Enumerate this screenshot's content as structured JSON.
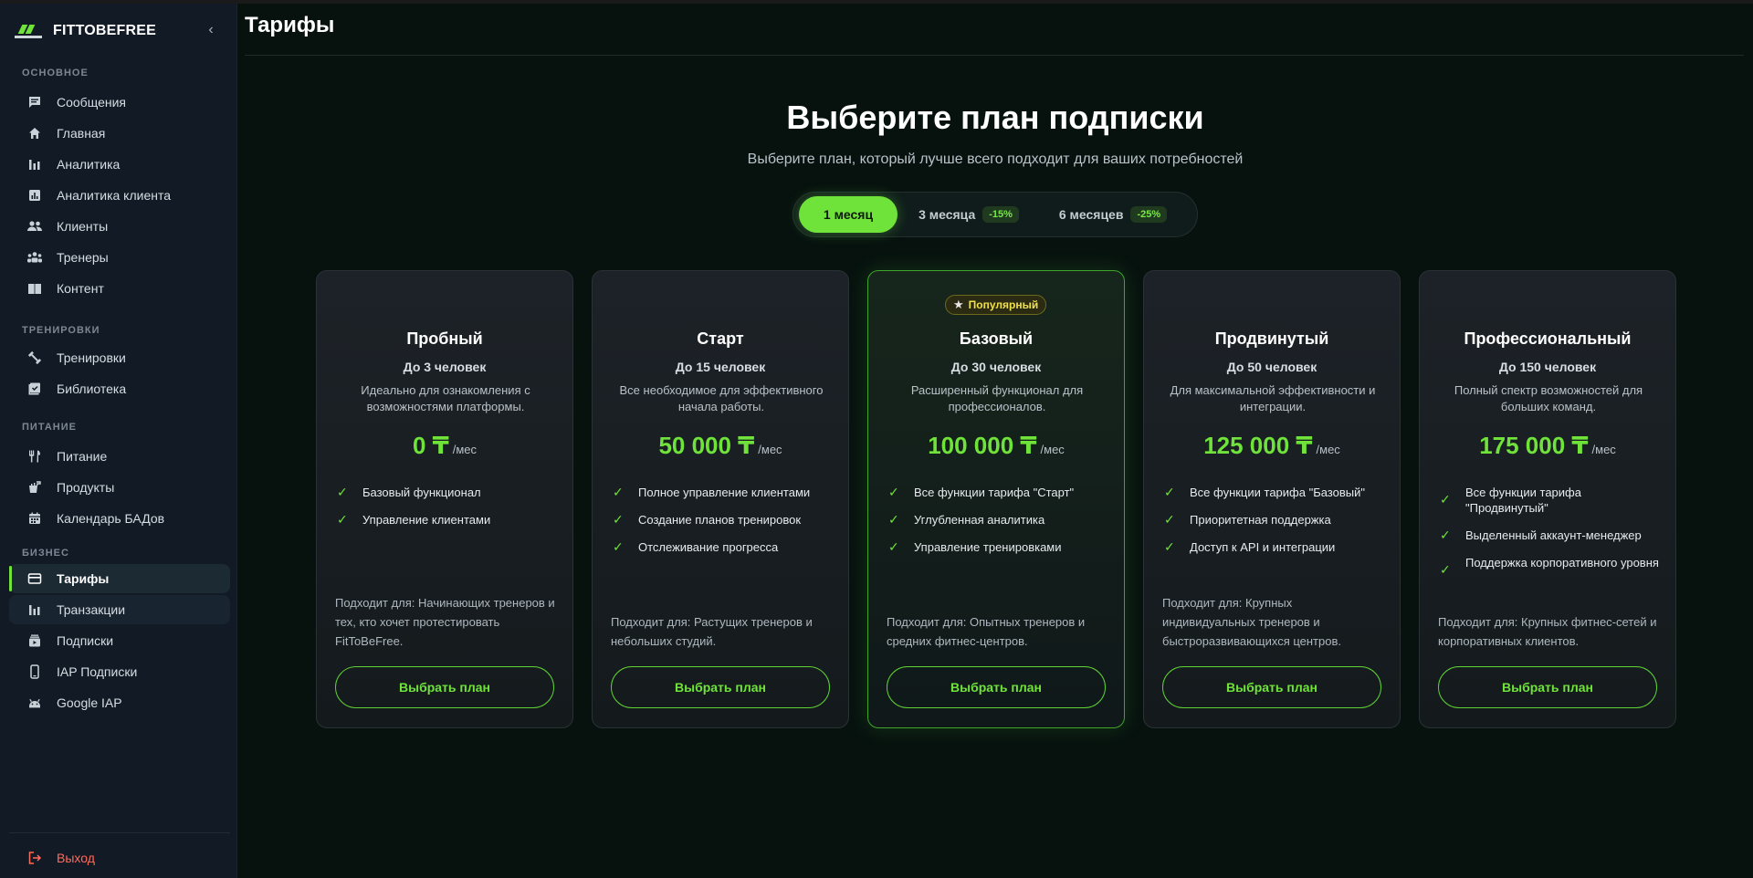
{
  "app": {
    "brand_name": "FITTOBEFREE",
    "collapse_icon": "chevron-left-icon"
  },
  "sidebar": {
    "sections": [
      {
        "title": "ОСНОВНОЕ",
        "items": [
          {
            "label": "Сообщения",
            "icon": "chat-icon"
          },
          {
            "label": "Главная",
            "icon": "home-icon"
          },
          {
            "label": "Аналитика",
            "icon": "bar-chart-icon"
          },
          {
            "label": "Аналитика клиента",
            "icon": "report-icon"
          },
          {
            "label": "Клиенты",
            "icon": "people-icon"
          },
          {
            "label": "Тренеры",
            "icon": "groups-icon"
          },
          {
            "label": "Контент",
            "icon": "book-icon"
          }
        ]
      },
      {
        "title": "ТРЕНИРОВКИ",
        "items": [
          {
            "label": "Тренировки",
            "icon": "dumbbell-icon"
          },
          {
            "label": "Библиотека",
            "icon": "library-icon"
          }
        ]
      },
      {
        "title": "ПИТАНИЕ",
        "items": [
          {
            "label": "Питание",
            "icon": "fork-knife-icon"
          },
          {
            "label": "Продукты",
            "icon": "grocery-icon"
          },
          {
            "label": "Календарь БАДов",
            "icon": "calendar-icon"
          }
        ]
      },
      {
        "title": "БИЗНЕС",
        "items": [
          {
            "label": "Тарифы",
            "icon": "card-icon",
            "active": true
          },
          {
            "label": "Транзакции",
            "icon": "bar-chart-icon"
          },
          {
            "label": "Подписки",
            "icon": "subscriptions-icon"
          },
          {
            "label": "IAP Подписки",
            "icon": "phone-icon"
          },
          {
            "label": "Google IAP",
            "icon": "android-icon"
          }
        ]
      }
    ],
    "logout_label": "Выход"
  },
  "page": {
    "title": "Тарифы",
    "hero_title": "Выберите план подписки",
    "hero_subtitle": "Выберите план, который лучше всего подходит для ваших потребностей"
  },
  "periods": [
    {
      "label": "1 месяц",
      "discount": "",
      "active": true
    },
    {
      "label": "3 месяца",
      "discount": "-15%",
      "active": false
    },
    {
      "label": "6 месяцев",
      "discount": "-25%",
      "active": false
    }
  ],
  "plans": [
    {
      "name": "Пробный",
      "people": "До 3 человек",
      "description": "Идеально для ознакомления с возможностями платформы.",
      "price": "0 ₸",
      "per": "/мес",
      "features": [
        "Базовый функционал",
        "Управление клиентами"
      ],
      "fit": "Подходит для: Начинающих тренеров и тех, кто хочет протестировать FitToBeFree.",
      "button": "Выбрать план",
      "popular": ""
    },
    {
      "name": "Старт",
      "people": "До 15 человек",
      "description": "Все необходимое для эффективного начала работы.",
      "price": "50 000 ₸",
      "per": "/мес",
      "features": [
        "Полное управление клиентами",
        "Создание планов тренировок",
        "Отслеживание прогресса"
      ],
      "fit": "Подходит для: Растущих тренеров и небольших студий.",
      "button": "Выбрать план",
      "popular": ""
    },
    {
      "name": "Базовый",
      "people": "До 30 человек",
      "description": "Расширенный функционал для профессионалов.",
      "price": "100 000 ₸",
      "per": "/мес",
      "features": [
        "Все функции тарифа \"Старт\"",
        "Углубленная аналитика",
        "Управление тренировками"
      ],
      "fit": "Подходит для: Опытных тренеров и средних фитнес-центров.",
      "button": "Выбрать план",
      "popular": "Популярный"
    },
    {
      "name": "Продвинутый",
      "people": "До 50 человек",
      "description": "Для максимальной эффективности и интеграции.",
      "price": "125 000 ₸",
      "per": "/мес",
      "features": [
        "Все функции тарифа \"Базовый\"",
        "Приоритетная поддержка",
        "Доступ к API и интеграции"
      ],
      "fit": "Подходит для: Крупных индивидуальных тренеров и быстроразвивающихся центров.",
      "button": "Выбрать план",
      "popular": ""
    },
    {
      "name": "Профессиональный",
      "people": "До 150 человек",
      "description": "Полный спектр возможностей для больших команд.",
      "price": "175 000 ₸",
      "per": "/мес",
      "features": [
        "Все функции тарифа \"Продвинутый\"",
        "Выделенный аккаунт-менеджер",
        "Поддержка корпоративного уровня"
      ],
      "fit": "Подходит для: Крупных фитнес-сетей и корпоративных клиентов.",
      "button": "Выбрать план",
      "popular": ""
    }
  ],
  "colors": {
    "accent": "#6fe33a",
    "logout": "#ff6b5b",
    "popular": "#f0e14a"
  }
}
